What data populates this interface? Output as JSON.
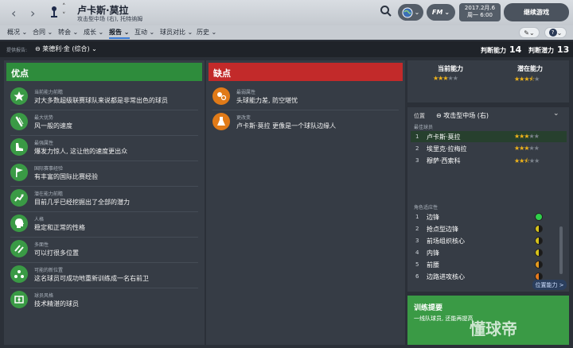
{
  "header": {
    "player_name": "卢卡斯·莫拉",
    "player_sub": "攻击型中场 (右), 托特纳姆",
    "date_line1": "2017.2月.6",
    "date_line2": "周一 6:00",
    "continue_label": "继续游戏",
    "fm_label": "FM"
  },
  "menu": {
    "items": [
      "概况",
      "合同",
      "转会",
      "成长",
      "报告",
      "互动",
      "球员对比",
      "历史"
    ],
    "active_index": 4
  },
  "subheader": {
    "provider_label": "提供报告:",
    "provider_value": "莱德利·金 (综合)",
    "judge_ability_label": "判断能力",
    "judge_ability_value": "14",
    "judge_potential_label": "判断潜力",
    "judge_potential_value": "13"
  },
  "strengths": {
    "title": "优点",
    "items": [
      {
        "label": "当前能力前瞻",
        "text": "对大多数超级联赛球队来说都是非常出色的球员",
        "icon": "star-icon"
      },
      {
        "label": "最大优势",
        "text": "风一般的速度",
        "icon": "speed-icon"
      },
      {
        "label": "最强属性",
        "text": "爆发力惊人, 这让他的速度更出众",
        "icon": "boot-icon"
      },
      {
        "label": "国际赛事经验",
        "text": "有丰富的国际比赛经验",
        "icon": "flag-icon"
      },
      {
        "label": "潜在能力前瞻",
        "text": "目前几乎已经挖掘出了全部的潜力",
        "icon": "growth-icon"
      },
      {
        "label": "人格",
        "text": "稳定和正常的性格",
        "icon": "head-icon"
      },
      {
        "label": "多面性",
        "text": "可以打很多位置",
        "icon": "versatility-icon"
      },
      {
        "label": "可能的新位置",
        "text": "这名球员可成功地重新训练成一名右前卫",
        "icon": "position-icon"
      },
      {
        "label": "球员风格",
        "text": "技术精湛的球员",
        "icon": "style-icon"
      }
    ]
  },
  "weaknesses": {
    "title": "缺点",
    "items": [
      {
        "label": "最弱属性",
        "text": "头球能力差, 防空堪忧",
        "icon": "header-weak-icon"
      },
      {
        "label": "更改变",
        "text": "卢卡斯·莫拉 更像是一个球队边缘人",
        "icon": "flask-icon"
      }
    ]
  },
  "ability": {
    "current_label": "当前能力",
    "potential_label": "潜在能力",
    "current_stars": 3,
    "potential_stars": 3.5
  },
  "positions": {
    "header": "位置",
    "selected": "攻击型中场 (右)",
    "best_label": "最佳球员",
    "players": [
      {
        "rank": "1",
        "name": "卢卡斯·莫拉",
        "stars": 3
      },
      {
        "rank": "2",
        "name": "埃里克·拉梅拉",
        "stars": 3
      },
      {
        "rank": "3",
        "name": "穆萨·西索科",
        "stars": 2.5
      }
    ],
    "roles_label": "角色适应性",
    "roles": [
      {
        "rank": "1",
        "name": "边锋",
        "level": "natural",
        "color": "#2fd04a"
      },
      {
        "rank": "2",
        "name": "抢点型边锋",
        "level": "half",
        "color": "#d6c21a"
      },
      {
        "rank": "3",
        "name": "前场组织核心",
        "level": "half",
        "color": "#d6c21a"
      },
      {
        "rank": "4",
        "name": "内锋",
        "level": "half",
        "color": "#d6c21a"
      },
      {
        "rank": "5",
        "name": "前腰",
        "level": "half",
        "color": "#e59a1e"
      },
      {
        "rank": "6",
        "name": "边路进攻核心",
        "level": "half",
        "color": "#e57a1e"
      }
    ],
    "button_label": "位置能力 >"
  },
  "training": {
    "title": "训练提要",
    "text": "一线队球员, 还能再提高"
  },
  "watermark": "懂球帝"
}
